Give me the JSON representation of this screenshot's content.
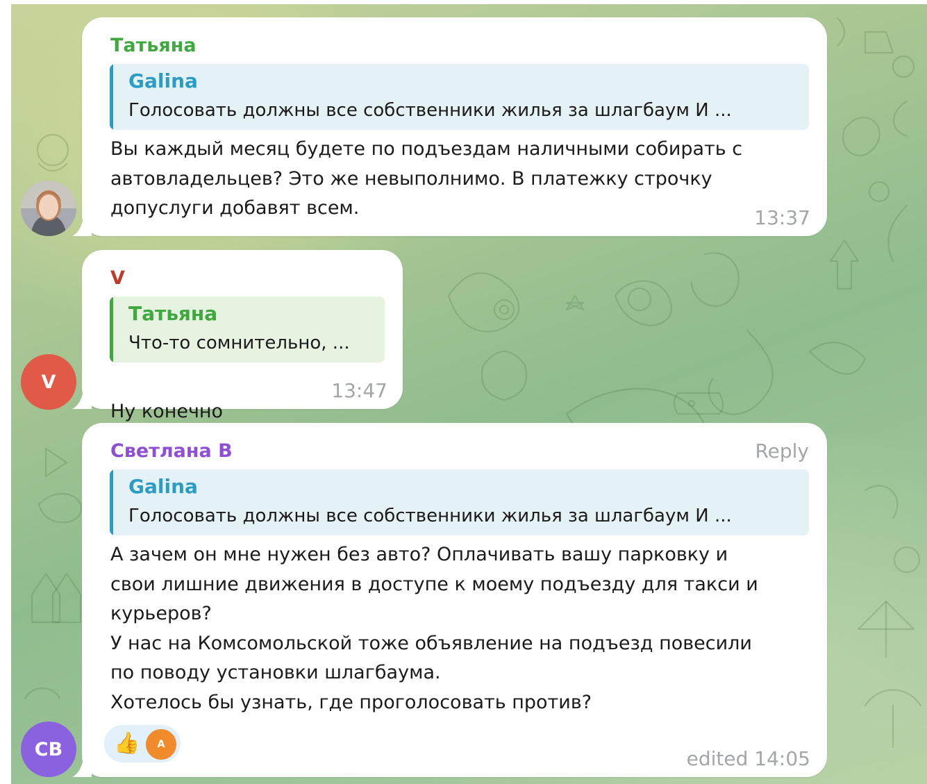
{
  "messages": [
    {
      "sender": "Татьяна",
      "sender_color": "#3fa83f",
      "reply_to": {
        "name": "Galina",
        "text": "Голосовать должны все собственники жилья за шлагбаум И ...",
        "accent": "#2b9cc4"
      },
      "text": "Вы каждый месяц будете по подъездам наличными собирать с\nавтовладельцев? Это же невыполнимо. В платежку строчку\nдопуслуги добавят всем.",
      "time": "13:37",
      "avatar": {
        "type": "photo",
        "icon": "user-photo"
      }
    },
    {
      "sender": "V",
      "sender_color": "#c0392b",
      "reply_to": {
        "name": "Татьяна",
        "text": "Что-то сомнительно, ...",
        "accent": "#3fa83f"
      },
      "text": "Ну конечно",
      "emoji": "😂",
      "time": "13:47",
      "avatar": {
        "type": "initials",
        "initials": "V",
        "color": "#e05a47"
      }
    },
    {
      "sender": "Светлана В",
      "sender_color": "#8e4fd6",
      "reply_link": "Reply",
      "reply_to": {
        "name": "Galina",
        "text": "Голосовать должны все собственники жилья за шлагбаум И ...",
        "accent": "#2b9cc4"
      },
      "text": "А зачем он мне нужен без авто? Оплачивать вашу парковку и\nсвои лишние движения в доступе к моему подъезду для такси и\nкурьеров?\nУ нас на Комсомольской тоже объявление на подъезд повесили\nпо поводу установки шлагбаума.\nХотелось бы узнать, где проголосовать против?",
      "reactions": {
        "emoji": "👍",
        "reactor_initial": "A"
      },
      "time": "edited 14:05",
      "avatar": {
        "type": "initials",
        "initials": "СВ",
        "color": "#8a62e0"
      }
    }
  ]
}
